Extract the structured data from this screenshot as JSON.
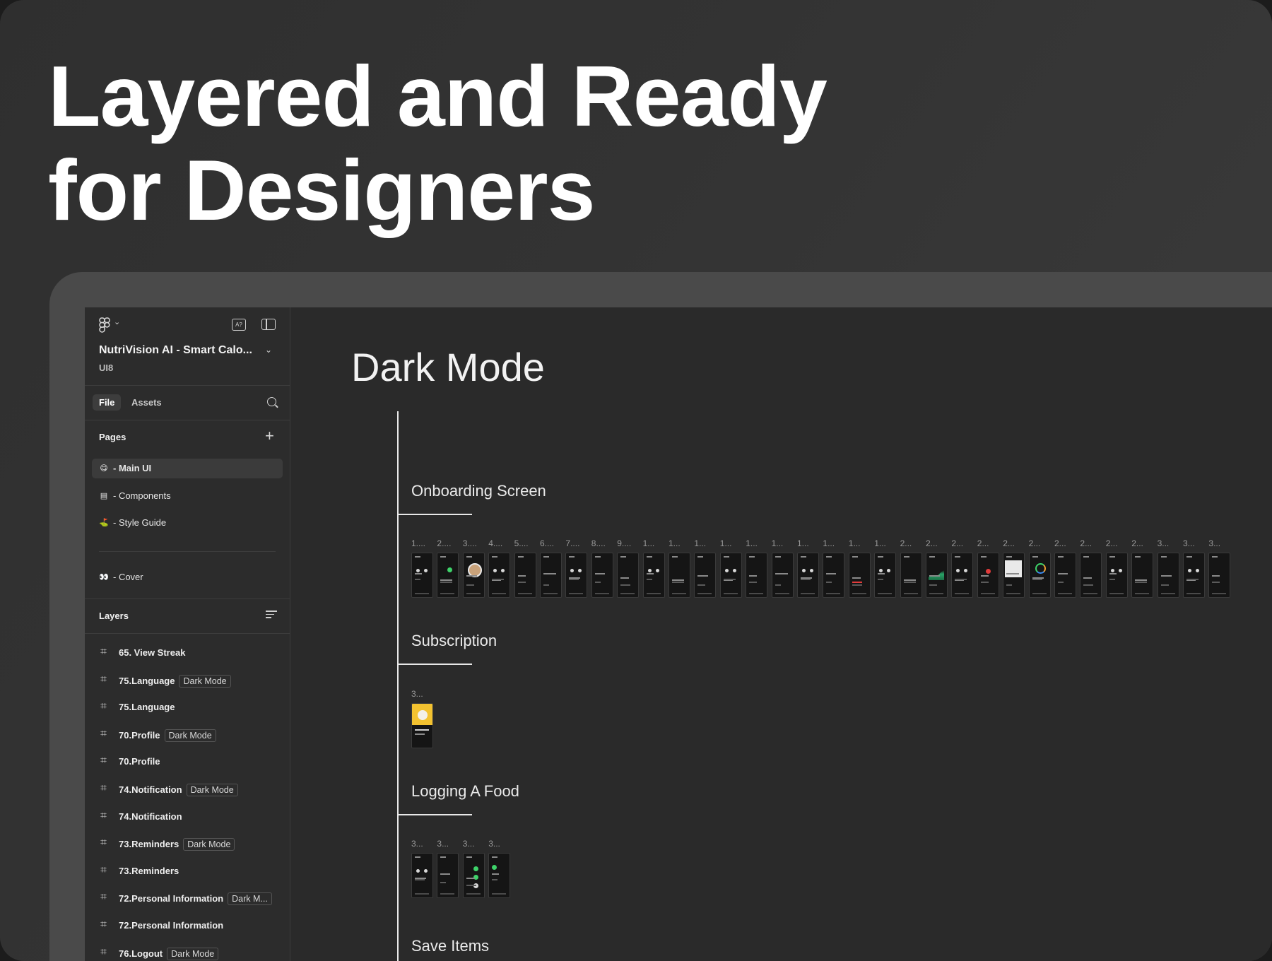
{
  "headline": {
    "line1": "Layered and Ready",
    "line2": "for Designers"
  },
  "sidebar": {
    "file_name": "NutriVision AI - Smart Calo...",
    "file_subtitle": "UI8",
    "tabs": {
      "file": "File",
      "assets": "Assets"
    },
    "pages_heading": "Pages",
    "pages": [
      {
        "icon": "😋",
        "label": "- Main UI",
        "active": true
      },
      {
        "icon": "▤",
        "label": "- Components",
        "active": false
      },
      {
        "icon": "⛳",
        "label": "- Style Guide",
        "active": false
      },
      {
        "icon": "👀",
        "label": "- Cover",
        "active": false
      }
    ],
    "layers_heading": "Layers",
    "layers": [
      {
        "name": "65. View Streak",
        "tag": ""
      },
      {
        "name": "75.Language",
        "tag": "Dark Mode"
      },
      {
        "name": "75.Language",
        "tag": ""
      },
      {
        "name": "70.Profile",
        "tag": "Dark Mode"
      },
      {
        "name": "70.Profile",
        "tag": ""
      },
      {
        "name": "74.Notification",
        "tag": "Dark Mode"
      },
      {
        "name": "74.Notification",
        "tag": ""
      },
      {
        "name": "73.Reminders",
        "tag": "Dark Mode"
      },
      {
        "name": "73.Reminders",
        "tag": ""
      },
      {
        "name": "72.Personal Information",
        "tag": "Dark M..."
      },
      {
        "name": "72.Personal Information",
        "tag": ""
      },
      {
        "name": "76.Logout",
        "tag": "Dark Mode"
      }
    ]
  },
  "canvas": {
    "title": "Dark Mode",
    "sections": [
      {
        "title": "Onboarding Screen",
        "thumb_labels": [
          "1....",
          "2....",
          "3....",
          "4....",
          "5....",
          "6....",
          "7....",
          "8....",
          "9....",
          "1...",
          "1...",
          "1...",
          "1...",
          "1...",
          "1...",
          "1...",
          "1...",
          "1...",
          "1...",
          "2...",
          "2...",
          "2...",
          "2...",
          "2...",
          "2...",
          "2...",
          "2...",
          "2...",
          "2...",
          "3...",
          "3...",
          "3..."
        ]
      },
      {
        "title": "Subscription",
        "thumb_labels": [
          "3..."
        ]
      },
      {
        "title": "Logging A Food",
        "thumb_labels": [
          "3...",
          "3...",
          "3...",
          "3..."
        ]
      },
      {
        "title": "Save Items",
        "thumb_labels": []
      }
    ]
  },
  "colors": {
    "accent_green": "#3ed36a",
    "tag_border": "#555555",
    "subscription_yellow": "#f3c230"
  }
}
